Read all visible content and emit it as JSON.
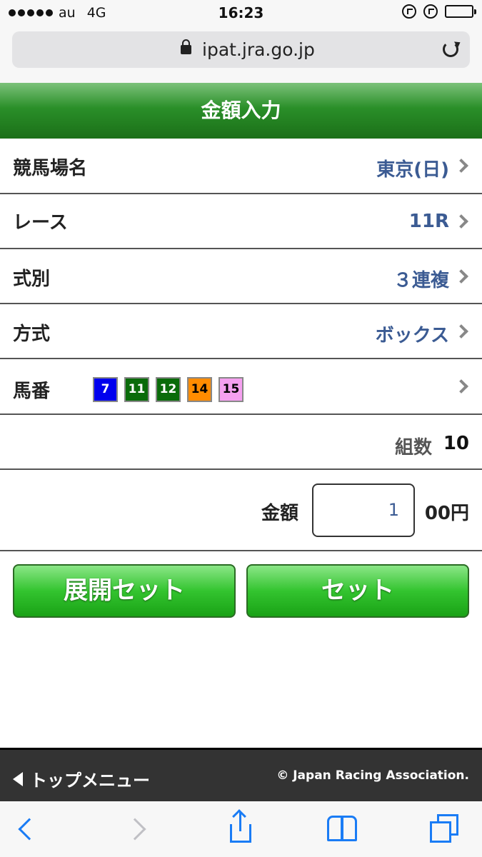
{
  "status_bar": {
    "carrier": "au",
    "network": "4G",
    "time": "16:23"
  },
  "browser": {
    "url": "ipat.jra.go.jp"
  },
  "page": {
    "title": "金額入力"
  },
  "rows": {
    "venue": {
      "label": "競馬場名",
      "value": "東京(日)"
    },
    "race": {
      "label": "レース",
      "value": "11R"
    },
    "bet_type": {
      "label": "式別",
      "value": "３連複"
    },
    "method": {
      "label": "方式",
      "value": "ボックス"
    },
    "horses": {
      "label": "馬番",
      "items": [
        {
          "number": "7",
          "bg": "#0000ee",
          "fg": "#ffffff"
        },
        {
          "number": "11",
          "bg": "#0a6b0a",
          "fg": "#ffffff"
        },
        {
          "number": "12",
          "bg": "#0a6b0a",
          "fg": "#ffffff"
        },
        {
          "number": "14",
          "bg": "#ff8c00",
          "fg": "#000000"
        },
        {
          "number": "15",
          "bg": "#f5a0f0",
          "fg": "#000000"
        }
      ]
    },
    "combinations": {
      "label": "組数",
      "value": "10"
    },
    "amount": {
      "label": "金額",
      "value": "1",
      "unit": "00円"
    }
  },
  "buttons": {
    "expand_set": "展開セット",
    "set": "セット"
  },
  "footer": {
    "back_label": "トップメニュー",
    "copyright": "© Japan Racing Association."
  },
  "colors": {
    "header_green": "#1b6f18",
    "button_green": "#33c42f",
    "value_blue": "#3b5b93",
    "ios_blue": "#1a7cf5"
  }
}
